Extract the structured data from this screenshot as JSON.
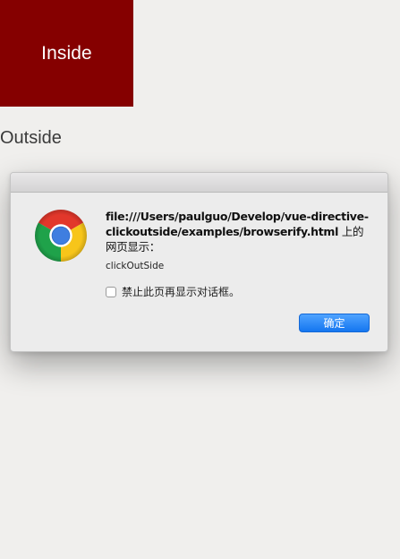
{
  "inside_label": "Inside",
  "outside_label": "Outside",
  "dialog": {
    "title_prefix": "file:///Users/paulguo/Develop/vue-directive-clickoutside/examples/browserify.html",
    "title_suffix": " 上的网页显示：",
    "message": "clickOutSide",
    "checkbox_label": "禁止此页再显示对话框。",
    "checkbox_checked": false,
    "ok_label": "确定",
    "icon": "chrome-icon"
  },
  "colors": {
    "inside_bg": "#850000",
    "page_bg": "#f0efed",
    "button_blue": "#1476f0"
  }
}
